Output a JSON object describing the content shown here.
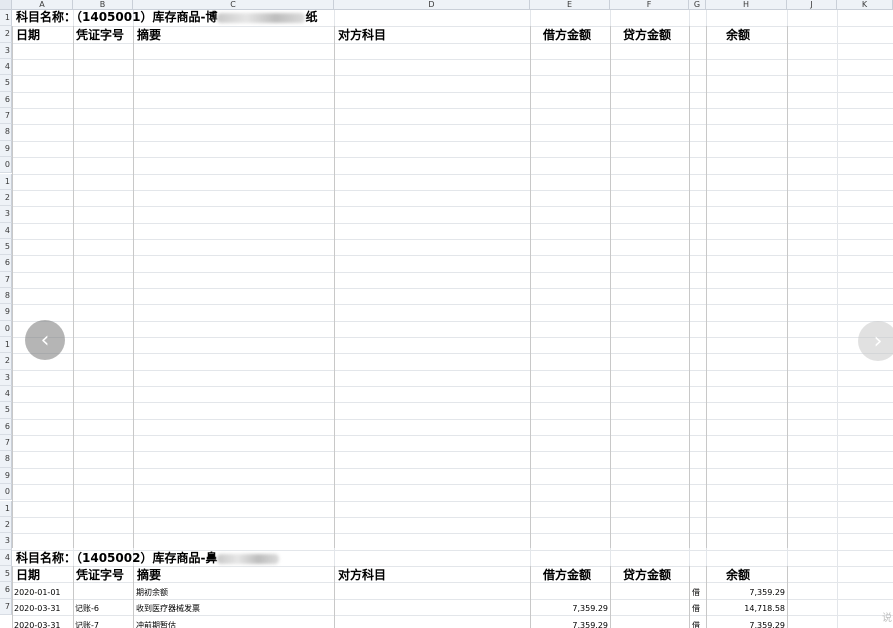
{
  "columns": [
    "A",
    "B",
    "C",
    "D",
    "E",
    "F",
    "G",
    "H",
    "J",
    "K"
  ],
  "row_labels": [
    "1",
    "2",
    "3",
    "4",
    "5",
    "6",
    "7",
    "8",
    "9",
    "0",
    "1",
    "2",
    "3",
    "4",
    "5",
    "6",
    "7",
    "8",
    "9",
    "0",
    "1",
    "2",
    "3",
    "4",
    "5",
    "6",
    "7",
    "8",
    "9",
    "0",
    "1",
    "2",
    "3",
    "4",
    "5",
    "6",
    "7"
  ],
  "section1": {
    "title_prefix": "科目名称：（1405001）库存商品-",
    "title_mid": "博",
    "title_suffix": "纸"
  },
  "section2": {
    "title_prefix": "科目名称：（1405002）库存商品-",
    "title_mid": "鼻"
  },
  "headers": {
    "date": "日期",
    "voucher": "凭证字号",
    "summary": "摘要",
    "counter": "对方科目",
    "debit": "借方金额",
    "credit": "贷方金额",
    "balance": "余额"
  },
  "rows": [
    {
      "date": "2020-01-01",
      "voucher": "",
      "summary": "期初余额",
      "debit": "",
      "dir": "借",
      "balance": "7,359.29"
    },
    {
      "date": "2020-03-31",
      "voucher": "记账-6",
      "summary": "收到医疗器械发票",
      "debit": "7,359.29",
      "dir": "借",
      "balance": "14,718.58"
    },
    {
      "date": "2020-03-31",
      "voucher": "记账-7",
      "summary": "冲前期暂估",
      "debit": "7,359.29",
      "dir": "借",
      "balance": "7,359.29"
    }
  ],
  "nav": {
    "prev_icon": "chevron-left-icon",
    "next_icon": "chevron-right-icon"
  },
  "corner_text": "说"
}
